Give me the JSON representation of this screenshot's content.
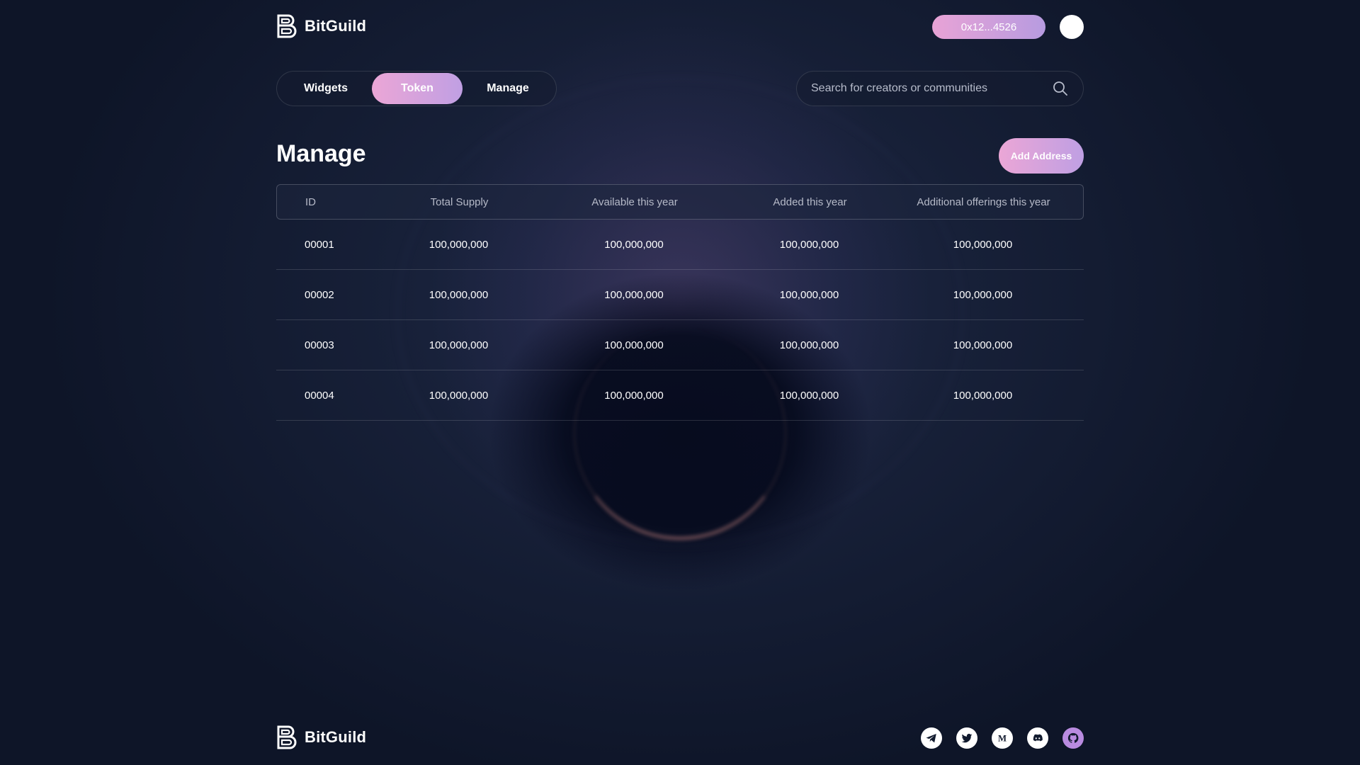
{
  "header": {
    "logo_text": "BitGuild",
    "wallet_address": "0x12...4526"
  },
  "tabs": [
    {
      "label": "Widgets",
      "active": false
    },
    {
      "label": "Token",
      "active": true
    },
    {
      "label": "Manage",
      "active": false
    }
  ],
  "search": {
    "placeholder": "Search for creators or communities"
  },
  "page": {
    "title": "Manage",
    "add_button": "Add Address"
  },
  "table": {
    "columns": [
      "ID",
      "Total Supply",
      "Available this year",
      "Added this year",
      "Additional offerings this year"
    ],
    "rows": [
      [
        "00001",
        "100,000,000",
        "100,000,000",
        "100,000,000",
        "100,000,000"
      ],
      [
        "00002",
        "100,000,000",
        "100,000,000",
        "100,000,000",
        "100,000,000"
      ],
      [
        "00003",
        "100,000,000",
        "100,000,000",
        "100,000,000",
        "100,000,000"
      ],
      [
        "00004",
        "100,000,000",
        "100,000,000",
        "100,000,000",
        "100,000,000"
      ]
    ]
  },
  "footer": {
    "logo_text": "BitGuild",
    "socials": [
      "telegram-icon",
      "twitter-icon",
      "medium-icon",
      "discord-icon",
      "github-icon"
    ]
  },
  "colors": {
    "accent_start": "#eba6d6",
    "accent_end": "#c09fe3",
    "background": "#111a2e",
    "github": "#b98be0"
  }
}
